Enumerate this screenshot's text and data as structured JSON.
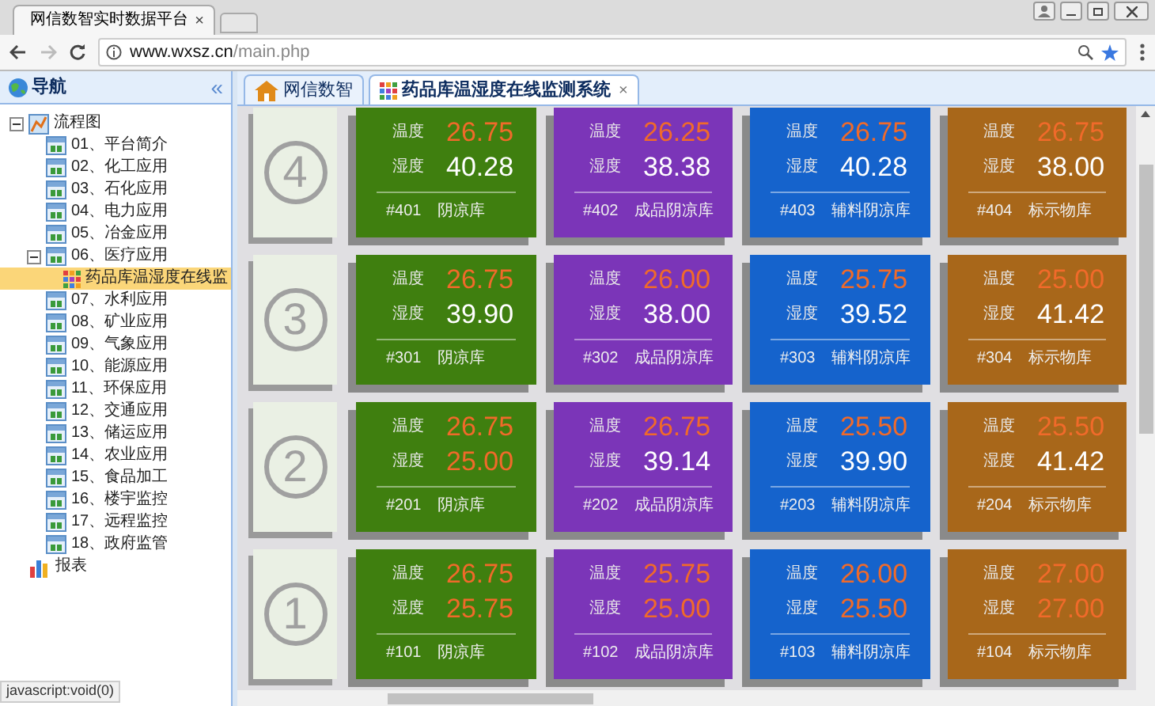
{
  "browser": {
    "tab_title": "网信数智实时数据平台",
    "tab_close": "×",
    "url_host": "www.wxsz.cn",
    "url_path": "/main.php",
    "status": "javascript:void(0)"
  },
  "nav": {
    "title": "导航",
    "collapse": "«",
    "tree": [
      {
        "label": "流程图",
        "kind": "flow",
        "expanded": true,
        "selected": false,
        "children": [
          {
            "label": "01、平台简介",
            "kind": "app",
            "selected": false
          },
          {
            "label": "02、化工应用",
            "kind": "app",
            "selected": false
          },
          {
            "label": "03、石化应用",
            "kind": "app",
            "selected": false
          },
          {
            "label": "04、电力应用",
            "kind": "app",
            "selected": false
          },
          {
            "label": "05、冶金应用",
            "kind": "app",
            "selected": false
          },
          {
            "label": "06、医疗应用",
            "kind": "app",
            "expanded": true,
            "selected": false,
            "children": [
              {
                "label": "药品库温湿度在线监",
                "kind": "grid",
                "selected": true
              }
            ]
          },
          {
            "label": "07、水利应用",
            "kind": "app",
            "selected": false
          },
          {
            "label": "08、矿业应用",
            "kind": "app",
            "selected": false
          },
          {
            "label": "09、气象应用",
            "kind": "app",
            "selected": false
          },
          {
            "label": "10、能源应用",
            "kind": "app",
            "selected": false
          },
          {
            "label": "11、环保应用",
            "kind": "app",
            "selected": false
          },
          {
            "label": "12、交通应用",
            "kind": "app",
            "selected": false
          },
          {
            "label": "13、储运应用",
            "kind": "app",
            "selected": false
          },
          {
            "label": "14、农业应用",
            "kind": "app",
            "selected": false
          },
          {
            "label": "15、食品加工",
            "kind": "app",
            "selected": false
          },
          {
            "label": "16、楼宇监控",
            "kind": "app",
            "selected": false
          },
          {
            "label": "17、远程监控",
            "kind": "app",
            "selected": false
          },
          {
            "label": "18、政府监管",
            "kind": "app",
            "selected": false
          }
        ]
      },
      {
        "label": "报表",
        "kind": "report",
        "selected": false
      }
    ]
  },
  "tabs": [
    {
      "label": "网信数智",
      "kind": "home",
      "selected": false
    },
    {
      "label": "药品库温湿度在线监测系统",
      "kind": "grid",
      "selected": true,
      "close": "×"
    }
  ],
  "floors": [
    {
      "number": "4",
      "rooms": [
        {
          "color": "#3f7f0f",
          "readings": [
            {
              "label": "温度",
              "value": "26.75",
              "alert": true
            },
            {
              "label": "湿度",
              "value": "40.28",
              "alert": false
            }
          ],
          "code": "#401",
          "name": "阴凉库"
        },
        {
          "color": "#7b35b8",
          "readings": [
            {
              "label": "温度",
              "value": "26.25",
              "alert": true
            },
            {
              "label": "湿度",
              "value": "38.38",
              "alert": false
            }
          ],
          "code": "#402",
          "name": "成品阴凉库"
        },
        {
          "color": "#1563cc",
          "readings": [
            {
              "label": "温度",
              "value": "26.75",
              "alert": true
            },
            {
              "label": "湿度",
              "value": "40.28",
              "alert": false
            }
          ],
          "code": "#403",
          "name": "辅料阴凉库"
        },
        {
          "color": "#a8671a",
          "readings": [
            {
              "label": "温度",
              "value": "26.75",
              "alert": true
            },
            {
              "label": "湿度",
              "value": "38.00",
              "alert": false
            }
          ],
          "code": "#404",
          "name": "标示物库"
        }
      ]
    },
    {
      "number": "3",
      "rooms": [
        {
          "color": "#3f7f0f",
          "readings": [
            {
              "label": "温度",
              "value": "26.75",
              "alert": true
            },
            {
              "label": "湿度",
              "value": "39.90",
              "alert": false
            }
          ],
          "code": "#301",
          "name": "阴凉库"
        },
        {
          "color": "#7b35b8",
          "readings": [
            {
              "label": "温度",
              "value": "26.00",
              "alert": true
            },
            {
              "label": "湿度",
              "value": "38.00",
              "alert": false
            }
          ],
          "code": "#302",
          "name": "成品阴凉库"
        },
        {
          "color": "#1563cc",
          "readings": [
            {
              "label": "温度",
              "value": "25.75",
              "alert": true
            },
            {
              "label": "湿度",
              "value": "39.52",
              "alert": false
            }
          ],
          "code": "#303",
          "name": "辅料阴凉库"
        },
        {
          "color": "#a8671a",
          "readings": [
            {
              "label": "温度",
              "value": "25.00",
              "alert": true
            },
            {
              "label": "湿度",
              "value": "41.42",
              "alert": false
            }
          ],
          "code": "#304",
          "name": "标示物库"
        }
      ]
    },
    {
      "number": "2",
      "rooms": [
        {
          "color": "#3f7f0f",
          "readings": [
            {
              "label": "温度",
              "value": "26.75",
              "alert": true
            },
            {
              "label": "湿度",
              "value": "25.00",
              "alert": true
            }
          ],
          "code": "#201",
          "name": "阴凉库"
        },
        {
          "color": "#7b35b8",
          "readings": [
            {
              "label": "温度",
              "value": "26.75",
              "alert": true
            },
            {
              "label": "湿度",
              "value": "39.14",
              "alert": false
            }
          ],
          "code": "#202",
          "name": "成品阴凉库"
        },
        {
          "color": "#1563cc",
          "readings": [
            {
              "label": "温度",
              "value": "25.50",
              "alert": true
            },
            {
              "label": "湿度",
              "value": "39.90",
              "alert": false
            }
          ],
          "code": "#203",
          "name": "辅料阴凉库"
        },
        {
          "color": "#a8671a",
          "readings": [
            {
              "label": "温度",
              "value": "25.50",
              "alert": true
            },
            {
              "label": "湿度",
              "value": "41.42",
              "alert": false
            }
          ],
          "code": "#204",
          "name": "标示物库"
        }
      ]
    },
    {
      "number": "1",
      "rooms": [
        {
          "color": "#3f7f0f",
          "readings": [
            {
              "label": "温度",
              "value": "26.75",
              "alert": true
            },
            {
              "label": "湿度",
              "value": "25.75",
              "alert": true
            }
          ],
          "code": "#101",
          "name": "阴凉库"
        },
        {
          "color": "#7b35b8",
          "readings": [
            {
              "label": "温度",
              "value": "25.75",
              "alert": true
            },
            {
              "label": "湿度",
              "value": "25.00",
              "alert": true
            }
          ],
          "code": "#102",
          "name": "成品阴凉库"
        },
        {
          "color": "#1563cc",
          "readings": [
            {
              "label": "温度",
              "value": "26.00",
              "alert": true
            },
            {
              "label": "湿度",
              "value": "25.50",
              "alert": true
            }
          ],
          "code": "#103",
          "name": "辅料阴凉库"
        },
        {
          "color": "#a8671a",
          "readings": [
            {
              "label": "温度",
              "value": "27.00",
              "alert": true
            },
            {
              "label": "湿度",
              "value": "27.00",
              "alert": true
            }
          ],
          "code": "#104",
          "name": "标示物库"
        }
      ]
    }
  ]
}
